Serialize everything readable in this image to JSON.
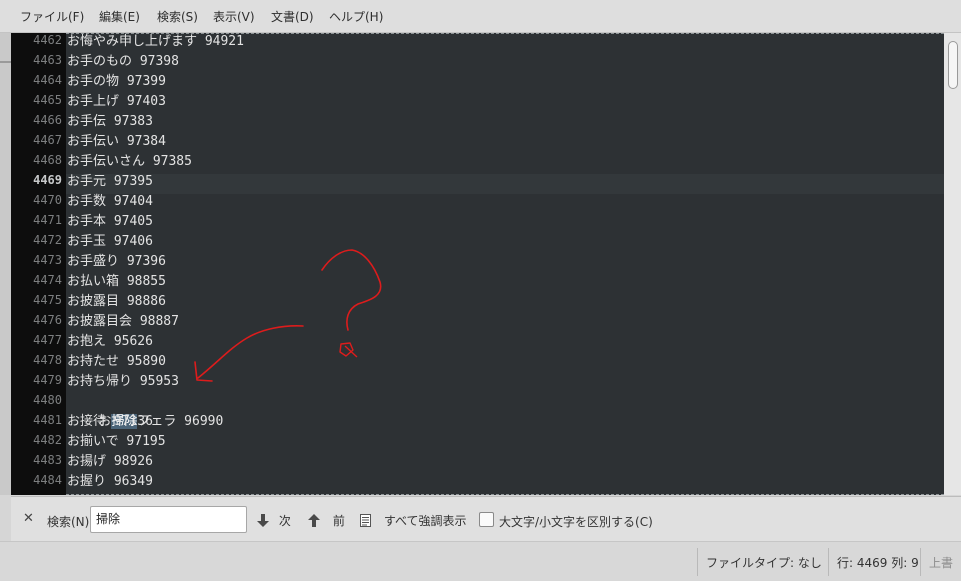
{
  "menu": [
    {
      "label": "ファイル(F)"
    },
    {
      "label": "編集(E)"
    },
    {
      "label": "検索(S)"
    },
    {
      "label": "表示(V)"
    },
    {
      "label": "文書(D)"
    },
    {
      "label": "ヘルプ(H)"
    }
  ],
  "editor": {
    "current_line_number": "4469",
    "lines": [
      {
        "num": "4462",
        "text": "お悔やみ申し上げます 94921"
      },
      {
        "num": "4463",
        "text": "お手のもの 97398"
      },
      {
        "num": "4464",
        "text": "お手の物 97399"
      },
      {
        "num": "4465",
        "text": "お手上げ 97403"
      },
      {
        "num": "4466",
        "text": "お手伝 97383"
      },
      {
        "num": "4467",
        "text": "お手伝い 97384"
      },
      {
        "num": "4468",
        "text": "お手伝いさん 97385"
      },
      {
        "num": "4469",
        "text": "お手元 97395"
      },
      {
        "num": "4470",
        "text": "お手数 97404"
      },
      {
        "num": "4471",
        "text": "お手本 97405"
      },
      {
        "num": "4472",
        "text": "お手玉 97406"
      },
      {
        "num": "4473",
        "text": "お手盛り 97396"
      },
      {
        "num": "4474",
        "text": "お払い箱 98855"
      },
      {
        "num": "4475",
        "text": "お披露目 98886"
      },
      {
        "num": "4476",
        "text": "お披露目会 98887"
      },
      {
        "num": "4477",
        "text": "お抱え 95626"
      },
      {
        "num": "4478",
        "text": "お持たせ 95890"
      },
      {
        "num": "4479",
        "text": "お持ち帰り 95953"
      },
      {
        "num": "4480",
        "text": "お掃除フェラ 96990",
        "match": "掃除"
      },
      {
        "num": "4481",
        "text": "お接待 97136"
      },
      {
        "num": "4482",
        "text": "お揃いで 97195"
      },
      {
        "num": "4483",
        "text": "お揚げ 98926"
      },
      {
        "num": "4484",
        "text": "お握り 96349"
      }
    ]
  },
  "annotation": {
    "color": "#dd1c1c"
  },
  "findbar": {
    "close_icon": "close-icon",
    "search_label": "検索(N)",
    "search_value": "掃除",
    "next_label": "次",
    "prev_label": "前",
    "highlight_all_label": "すべて強調表示",
    "case_label": "大文字/小文字を区別する(C)",
    "case_checked": false
  },
  "statusbar": {
    "filetype": "ファイルタイプ: なし",
    "position": "行: 4469 列: 9",
    "mode": "上書"
  },
  "colors": {
    "editor_bg": "#2d3134",
    "gutter_bg": "#0d0d0d",
    "match_bg": "#4b6478"
  }
}
